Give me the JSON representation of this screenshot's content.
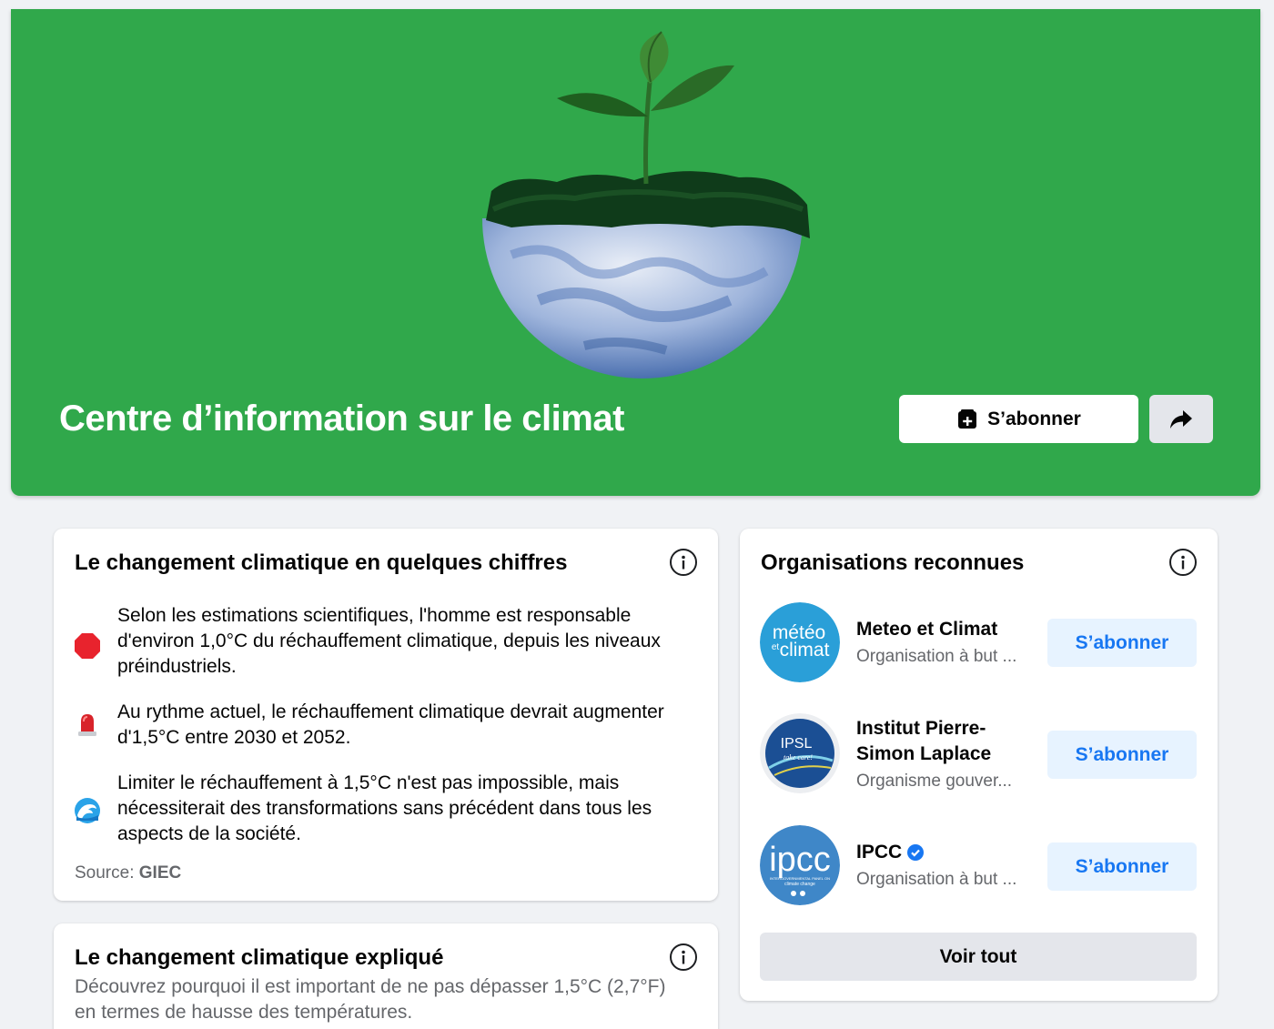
{
  "hero": {
    "title": "Centre d’information sur le climat",
    "subscribe_label": "S’abonner",
    "background_color": "#30a84b"
  },
  "facts_card": {
    "title": "Le changement climatique en quelques chiffres",
    "facts": [
      {
        "icon": "stop-sign-icon",
        "text": "Selon les estimations scientifiques, l'homme est responsable d'environ 1,0°C du réchauffement climatique, depuis les niveaux préindustriels."
      },
      {
        "icon": "siren-light-icon",
        "text": "Au rythme actuel, le réchauffement climatique devrait augmenter d'1,5°C entre 2030 et 2052."
      },
      {
        "icon": "water-wave-icon",
        "text": "Limiter le réchauffement à 1,5°C n'est pas impossible, mais nécessiterait des transformations sans précédent dans tous les aspects de la société."
      }
    ],
    "source_prefix": "Source: ",
    "source_name": "GIEC"
  },
  "explained_card": {
    "title": "Le changement climatique expliqué",
    "description": "Découvrez pourquoi il est important de ne pas dépasser 1,5°C (2,7°F) en termes de hausse des températures."
  },
  "orgs_card": {
    "title": "Organisations reconnues",
    "orgs": [
      {
        "name": "Meteo et Climat",
        "type": "Organisation à but ...",
        "subscribe_label": "S’abonner",
        "avatar_text": "météo",
        "avatar_text_2": "climat",
        "avatar_text_small": "et"
      },
      {
        "name_line1": "Institut Pierre-",
        "name_line2": "Simon Laplace",
        "type": "Organisme gouver...",
        "subscribe_label": "S’abonner",
        "avatar_text": "IPSL",
        "avatar_text_2": "take care!"
      },
      {
        "name": "IPCC",
        "type": "Organisation à but ...",
        "subscribe_label": "S’abonner",
        "avatar_text": "ipcc",
        "avatar_text_2": "INTERGOVERNMENTAL PANEL ON",
        "avatar_text_3": "climate change"
      }
    ],
    "see_all_label": "Voir tout"
  },
  "colors": {
    "accent": "#1877f2",
    "subscribe_bg": "#e7f3ff",
    "secondary_text": "#65676b",
    "page_bg": "#f0f2f5"
  }
}
